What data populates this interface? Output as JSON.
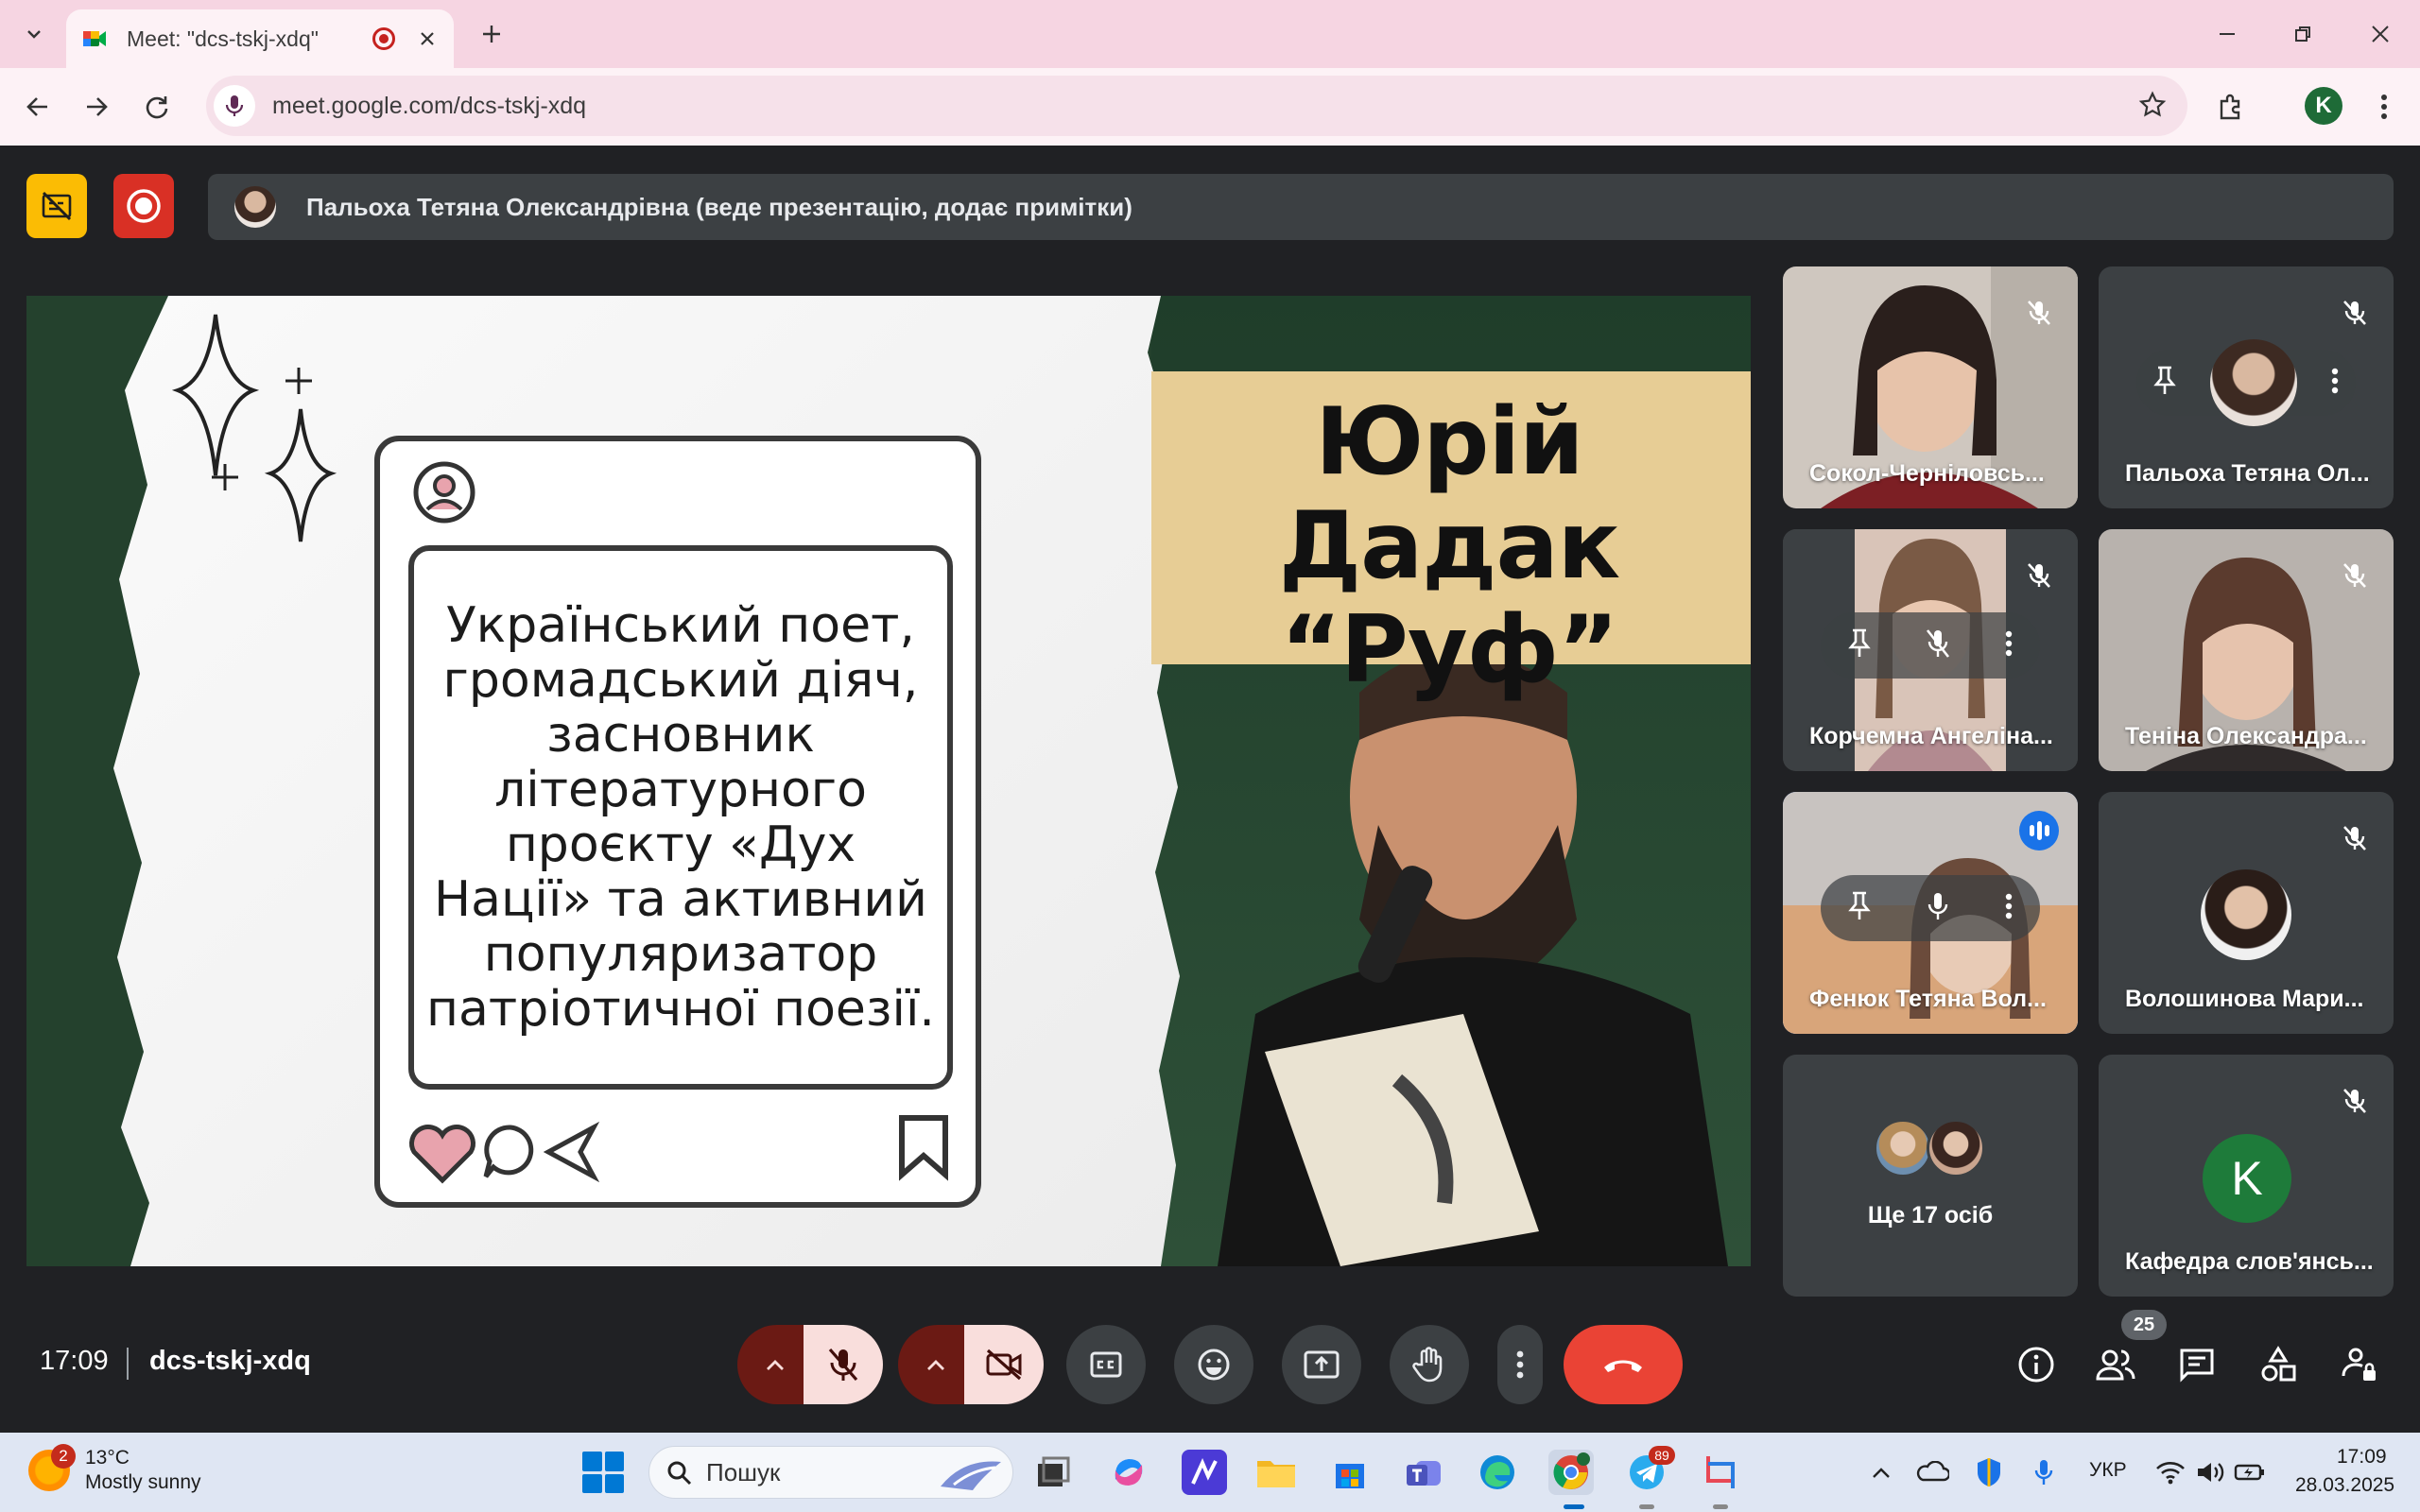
{
  "browser": {
    "tab_title": "Meet: \"dcs-tskj-xdq\"",
    "url": "meet.google.com/dcs-tskj-xdq",
    "profile_initial": "K"
  },
  "meet": {
    "presenter_text": "Пальоха Тетяна Олександрівна (веде презентацію, додає примітки)",
    "time": "17:09",
    "meeting_code": "dcs-tskj-xdq",
    "participants_count": "25"
  },
  "slide": {
    "title_line1": "Юрій Дадак",
    "title_line2": "“Руф”",
    "card_text": "Український поет, громадський діяч, засновник літературного проєкту «Дух Нації» та активний популяризатор патріотичної поезії."
  },
  "tiles": [
    {
      "name": "Сокол-Черніловсь..."
    },
    {
      "name": "Пальоха Тетяна Ол..."
    },
    {
      "name": "Корчемна Ангеліна..."
    },
    {
      "name": "Теніна Олександра..."
    },
    {
      "name": "Фенюк Тетяна Вол..."
    },
    {
      "name": "Волошинова Мари..."
    },
    {
      "name": "Ще 17 осіб"
    },
    {
      "name": "Кафедра слов'янсь...",
      "initial": "K"
    }
  ],
  "taskbar": {
    "weather_temp": "13°C",
    "weather_desc": "Mostly sunny",
    "weather_notifications": "2",
    "search_placeholder": "Пошук",
    "telegram_badge": "89",
    "language": "УКР",
    "time": "17:09",
    "date": "28.03.2025"
  },
  "colors": {
    "meet_background": "#202124",
    "end_call": "#ea4335",
    "active_speaker_outline": "#8ab4f8",
    "tab_strip": "#f6d5e2"
  }
}
